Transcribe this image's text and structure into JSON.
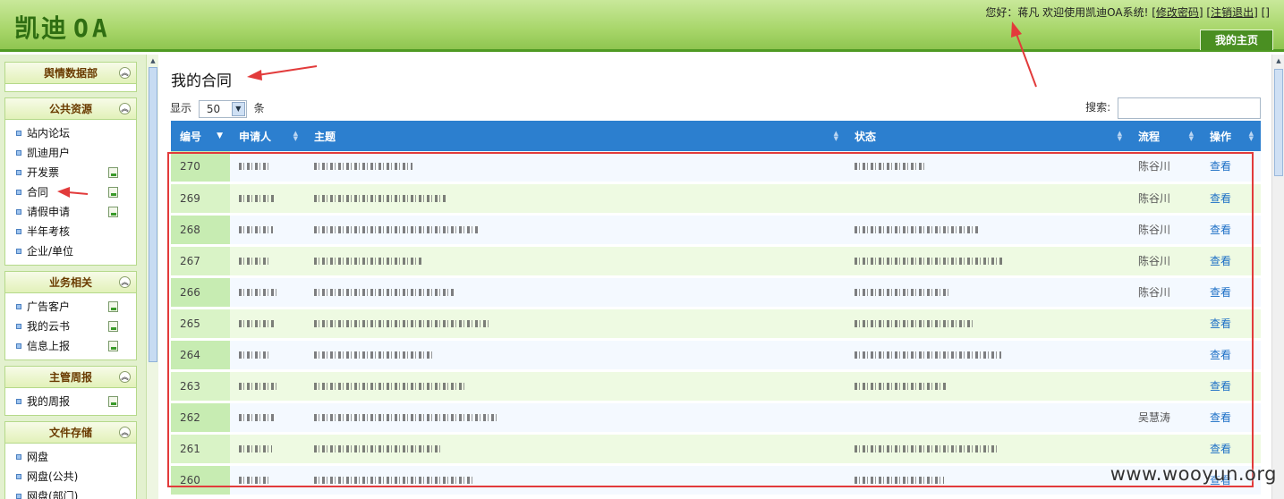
{
  "app": {
    "logo_cn": "凯迪",
    "logo_oa": "OA",
    "greeting": "您好：蒋凡  欢迎使用凯迪OA系统!",
    "change_password": "[修改密码]",
    "logout": "[注销退出]",
    "extra_bracket": "[]",
    "home_tab": "我的主页"
  },
  "sidebar": {
    "panels": [
      {
        "title": "舆情数据部",
        "items": []
      },
      {
        "title": "公共资源",
        "items": [
          {
            "label": "站内论坛",
            "add": false
          },
          {
            "label": "凯迪用户",
            "add": false
          },
          {
            "label": "开发票",
            "add": true
          },
          {
            "label": "合同",
            "add": true
          },
          {
            "label": "请假申请",
            "add": true
          },
          {
            "label": "半年考核",
            "add": false
          },
          {
            "label": "企业/单位",
            "add": false
          }
        ]
      },
      {
        "title": "业务相关",
        "items": [
          {
            "label": "广告客户",
            "add": true
          },
          {
            "label": "我的云书",
            "add": true
          },
          {
            "label": "信息上报",
            "add": true
          }
        ]
      },
      {
        "title": "主管周报",
        "items": [
          {
            "label": "我的周报",
            "add": true
          }
        ]
      },
      {
        "title": "文件存储",
        "items": [
          {
            "label": "网盘",
            "add": false
          },
          {
            "label": "网盘(公共)",
            "add": false
          },
          {
            "label": "网盘(部门)",
            "add": false
          }
        ]
      }
    ]
  },
  "main": {
    "title": "我的合同",
    "show_label": "显示",
    "page_size": "50",
    "unit_label": "条",
    "search_label": "搜索:",
    "columns": [
      "编号",
      "申请人",
      "主题",
      "状态",
      "流程",
      "操作"
    ],
    "rows": [
      {
        "id": "270",
        "flow": "陈谷川",
        "op": "查看"
      },
      {
        "id": "269",
        "flow": "陈谷川",
        "op": "查看"
      },
      {
        "id": "268",
        "flow": "陈谷川",
        "op": "查看"
      },
      {
        "id": "267",
        "flow": "陈谷川",
        "op": "查看"
      },
      {
        "id": "266",
        "flow": "陈谷川",
        "op": "查看"
      },
      {
        "id": "265",
        "flow": "",
        "op": "查看"
      },
      {
        "id": "264",
        "flow": "",
        "op": "查看"
      },
      {
        "id": "263",
        "flow": "",
        "op": "查看"
      },
      {
        "id": "262",
        "flow": "吴慧涛",
        "op": "查看"
      },
      {
        "id": "261",
        "flow": "",
        "op": "查看"
      },
      {
        "id": "260",
        "flow": "",
        "op": "查看"
      }
    ]
  },
  "watermark": "www.wooyun.org",
  "colors": {
    "header_green": "#8fc550",
    "table_header_blue": "#2c7fcf",
    "annotation_red": "#e23b3b"
  }
}
